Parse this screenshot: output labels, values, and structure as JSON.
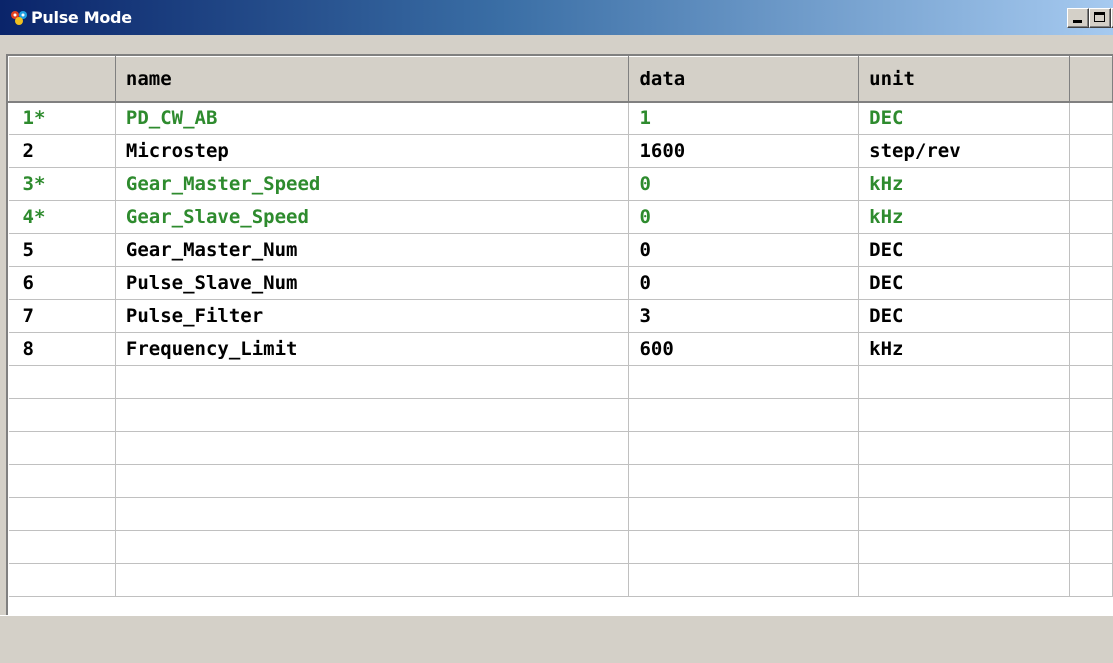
{
  "window": {
    "title": "Pulse Mode"
  },
  "columns": [
    "",
    "name",
    "data",
    "unit",
    ""
  ],
  "rows": [
    {
      "index": "1*",
      "name": "PD_CW_AB",
      "data": "1",
      "unit": "DEC",
      "highlight": true
    },
    {
      "index": "2",
      "name": "Microstep",
      "data": "1600",
      "unit": "step/rev",
      "highlight": false
    },
    {
      "index": "3*",
      "name": "Gear_Master_Speed",
      "data": "0",
      "unit": "kHz",
      "highlight": true
    },
    {
      "index": "4*",
      "name": "Gear_Slave_Speed",
      "data": "0",
      "unit": "kHz",
      "highlight": true
    },
    {
      "index": "5",
      "name": "Gear_Master_Num",
      "data": "0",
      "unit": "DEC",
      "highlight": false
    },
    {
      "index": "6",
      "name": "Pulse_Slave_Num",
      "data": "0",
      "unit": "DEC",
      "highlight": false
    },
    {
      "index": "7",
      "name": "Pulse_Filter",
      "data": "3",
      "unit": "DEC",
      "highlight": false
    },
    {
      "index": "8",
      "name": "Frequency_Limit",
      "data": "600",
      "unit": "kHz",
      "highlight": false
    }
  ],
  "empty_rows": 7,
  "colors": {
    "highlight_text": "#2e8b2e",
    "normal_text": "#000000",
    "title_bar": "#0a246a"
  }
}
